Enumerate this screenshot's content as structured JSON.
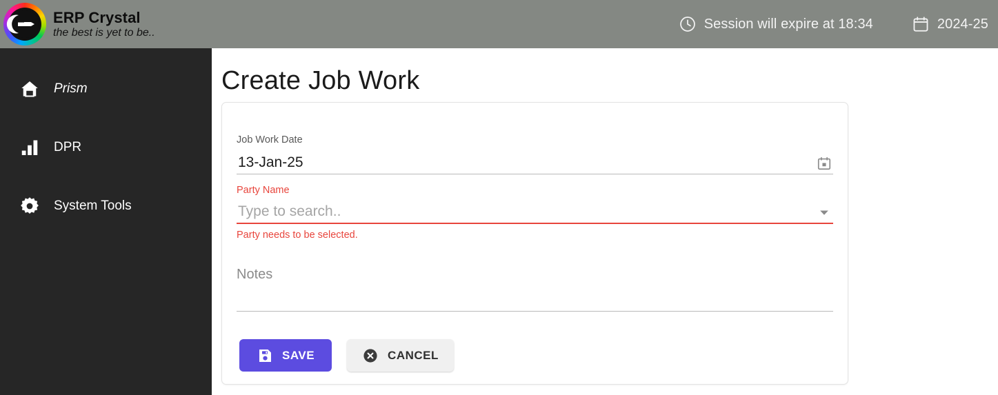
{
  "header": {
    "brand_title": "ERP Crystal",
    "brand_tagline": "the best is yet to be..",
    "logo_icon": "erp-crystal-logo",
    "session_icon": "clock-icon",
    "session_text": "Session will expire at 18:34",
    "fiscal_icon": "calendar-icon",
    "fiscal_year": "2024-25",
    "background_color": "#848883",
    "text_color": "#f3f3f3"
  },
  "sidebar": {
    "background_color": "#262626",
    "items": [
      {
        "label": "Prism",
        "icon": "home-icon",
        "italic": true
      },
      {
        "label": "DPR",
        "icon": "bar-chart-icon",
        "italic": false
      },
      {
        "label": "System Tools",
        "icon": "gear-icon",
        "italic": false
      }
    ]
  },
  "main": {
    "page_title": "Create Job Work",
    "form": {
      "job_work_date": {
        "label": "Job Work Date",
        "value": "13-Jan-25",
        "icon": "calendar-picker-icon"
      },
      "party_name": {
        "label": "Party Name",
        "value": "",
        "placeholder": "Type to search..",
        "error_message": "Party needs to be selected.",
        "error_color": "#e8453c",
        "icon": "chevron-down-icon"
      },
      "notes": {
        "label": "Notes",
        "value": "",
        "placeholder": "Notes"
      }
    },
    "buttons": {
      "save": {
        "label": "SAVE",
        "icon": "save-floppy-icon",
        "color": "#5c4ce0"
      },
      "cancel": {
        "label": "CANCEL",
        "icon": "circle-x-icon",
        "color": "#f0f0f0"
      }
    }
  }
}
